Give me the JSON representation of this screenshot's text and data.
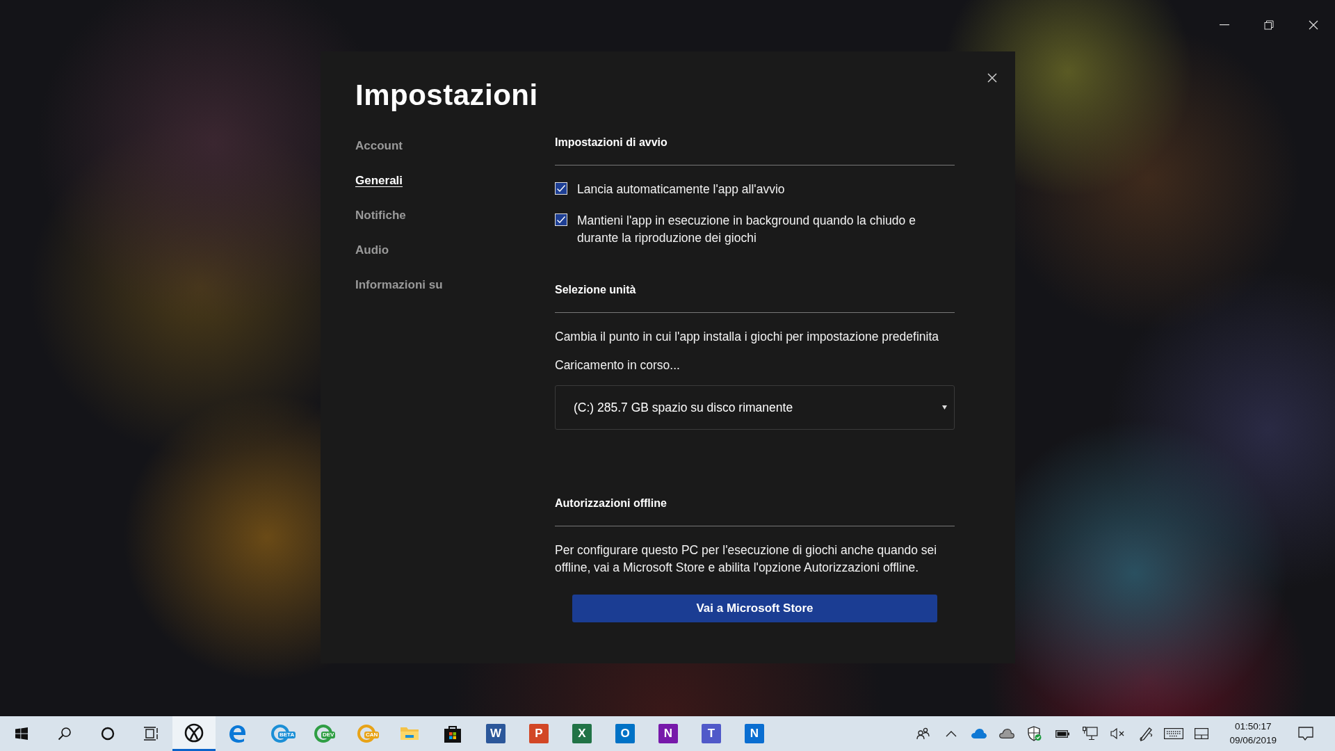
{
  "dialog": {
    "title": "Impostazioni",
    "nav": [
      {
        "label": "Account",
        "selected": false
      },
      {
        "label": "Generali",
        "selected": true
      },
      {
        "label": "Notifiche",
        "selected": false
      },
      {
        "label": "Audio",
        "selected": false
      },
      {
        "label": "Informazioni su",
        "selected": false
      }
    ],
    "sections": [
      {
        "heading": "Impostazioni di avvio",
        "options": [
          {
            "label": "Lancia automaticamente l'app all'avvio",
            "checked": true
          },
          {
            "label": "Mantieni l'app in esecuzione in background quando la chiudo e durante la riproduzione dei giochi",
            "checked": true
          }
        ]
      },
      {
        "heading": "Selezione unità",
        "description": "Cambia il punto in cui l'app installa i giochi per impostazione predefinita",
        "status": "Caricamento in corso...",
        "dropdown": {
          "value": "(C:) 285.7 GB spazio su disco rimanente"
        }
      },
      {
        "heading": "Autorizzazioni offline",
        "description": "Per configurare questo PC per l'esecuzione di giochi anche quando sei offline, vai a Microsoft Store e abilita l'opzione Autorizzazioni offline.",
        "button": "Vai a Microsoft Store"
      }
    ]
  },
  "taskbar": {
    "apps": [
      {
        "kind": "start",
        "active": false
      },
      {
        "kind": "search",
        "active": false
      },
      {
        "kind": "cortana",
        "active": false
      },
      {
        "kind": "task-view",
        "active": false
      },
      {
        "kind": "xbox",
        "active": true
      },
      {
        "kind": "edge",
        "active": false
      },
      {
        "kind": "edge-badge",
        "badge": "BETA",
        "color": "#1b8fd6",
        "active": false
      },
      {
        "kind": "edge-badge",
        "badge": "DEV",
        "color": "#2f9e44",
        "active": false
      },
      {
        "kind": "edge-badge",
        "badge": "CAN",
        "color": "#e8a317",
        "active": false
      },
      {
        "kind": "folder",
        "active": false
      },
      {
        "kind": "store",
        "active": false
      },
      {
        "kind": "office",
        "letter": "W",
        "color": "#2b579a",
        "active": false
      },
      {
        "kind": "office",
        "letter": "P",
        "color": "#d24726",
        "active": false
      },
      {
        "kind": "office",
        "letter": "X",
        "color": "#217346",
        "active": false
      },
      {
        "kind": "office",
        "letter": "O",
        "color": "#0072c6",
        "active": false
      },
      {
        "kind": "office",
        "letter": "N",
        "color": "#7719aa",
        "active": false
      },
      {
        "kind": "office",
        "letter": "T",
        "color": "#5059c9",
        "active": false
      },
      {
        "kind": "office",
        "letter": "N",
        "color": "#0a6ed1",
        "active": false
      }
    ],
    "tray": [
      {
        "kind": "people"
      },
      {
        "kind": "chevron"
      },
      {
        "kind": "cloud-blue"
      },
      {
        "kind": "cloud-grey"
      },
      {
        "kind": "shield"
      },
      {
        "kind": "battery"
      },
      {
        "kind": "network"
      },
      {
        "kind": "volume-muted"
      },
      {
        "kind": "pen"
      },
      {
        "kind": "keyboard"
      },
      {
        "kind": "touchpad"
      }
    ],
    "clock": {
      "time": "01:50:17",
      "date": "09/06/2019"
    }
  }
}
